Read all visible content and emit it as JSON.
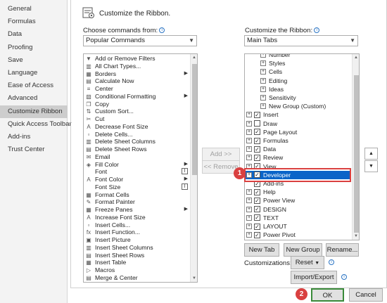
{
  "nav": [
    "General",
    "Formulas",
    "Data",
    "Proofing",
    "Save",
    "Language",
    "Ease of Access",
    "Advanced",
    "Customize Ribbon",
    "Quick Access Toolbar",
    "Add-ins",
    "Trust Center"
  ],
  "nav_selected": 8,
  "header": {
    "title": "Customize the Ribbon."
  },
  "left": {
    "label": "Choose commands from:",
    "select_value": "Popular Commands",
    "commands": [
      {
        "icon": "add-remove-filters-icon",
        "glyph": "▼",
        "label": "Add or Remove Filters"
      },
      {
        "icon": "all-chart-types-icon",
        "glyph": "▥",
        "label": "All Chart Types..."
      },
      {
        "icon": "borders-icon",
        "glyph": "▦",
        "label": "Borders",
        "sub": true
      },
      {
        "icon": "calculate-now-icon",
        "glyph": "▤",
        "label": "Calculate Now"
      },
      {
        "icon": "center-icon",
        "glyph": "≡",
        "label": "Center"
      },
      {
        "icon": "conditional-formatting-icon",
        "glyph": "▧",
        "label": "Conditional Formatting",
        "sub": true
      },
      {
        "icon": "copy-icon",
        "glyph": "❐",
        "label": "Copy"
      },
      {
        "icon": "custom-sort-icon",
        "glyph": "⇅",
        "label": "Custom Sort..."
      },
      {
        "icon": "cut-icon",
        "glyph": "✂",
        "label": "Cut"
      },
      {
        "icon": "decrease-font-size-icon",
        "glyph": "A",
        "label": "Decrease Font Size"
      },
      {
        "icon": "delete-cells-icon",
        "glyph": "▫",
        "label": "Delete Cells..."
      },
      {
        "icon": "delete-sheet-columns-icon",
        "glyph": "▥",
        "label": "Delete Sheet Columns"
      },
      {
        "icon": "delete-sheet-rows-icon",
        "glyph": "▤",
        "label": "Delete Sheet Rows"
      },
      {
        "icon": "email-icon",
        "glyph": "✉",
        "label": "Email"
      },
      {
        "icon": "fill-color-icon",
        "glyph": "◈",
        "label": "Fill Color",
        "sub": true
      },
      {
        "icon": "font-icon",
        "glyph": "",
        "label": "Font",
        "input": true
      },
      {
        "icon": "font-color-icon",
        "glyph": "A",
        "label": "Font Color",
        "sub": true
      },
      {
        "icon": "font-size-icon",
        "glyph": "",
        "label": "Font Size",
        "input": true
      },
      {
        "icon": "format-cells-icon",
        "glyph": "▦",
        "label": "Format Cells"
      },
      {
        "icon": "format-painter-icon",
        "glyph": "✎",
        "label": "Format Painter"
      },
      {
        "icon": "freeze-panes-icon",
        "glyph": "▦",
        "label": "Freeze Panes",
        "sub": true
      },
      {
        "icon": "increase-font-size-icon",
        "glyph": "A",
        "label": "Increase Font Size"
      },
      {
        "icon": "insert-cells-icon",
        "glyph": "▫",
        "label": "Insert Cells..."
      },
      {
        "icon": "insert-function-icon",
        "glyph": "fx",
        "label": "Insert Function..."
      },
      {
        "icon": "insert-picture-icon",
        "glyph": "▣",
        "label": "Insert Picture"
      },
      {
        "icon": "insert-sheet-columns-icon",
        "glyph": "▥",
        "label": "Insert Sheet Columns"
      },
      {
        "icon": "insert-sheet-rows-icon",
        "glyph": "▤",
        "label": "Insert Sheet Rows"
      },
      {
        "icon": "insert-table-icon",
        "glyph": "▦",
        "label": "Insert Table"
      },
      {
        "icon": "macros-icon",
        "glyph": "▷",
        "label": "Macros"
      },
      {
        "icon": "merge-center-icon",
        "glyph": "▤",
        "label": "Merge & Center"
      }
    ]
  },
  "middle": {
    "add": "Add >>",
    "remove": "<< Remove"
  },
  "right": {
    "label": "Customize the Ribbon:",
    "select_value": "Main Tabs",
    "tree": [
      {
        "level": 2,
        "pm": "+",
        "label": "Number"
      },
      {
        "level": 2,
        "pm": "+",
        "label": "Styles"
      },
      {
        "level": 2,
        "pm": "+",
        "label": "Cells"
      },
      {
        "level": 2,
        "pm": "+",
        "label": "Editing"
      },
      {
        "level": 2,
        "pm": "+",
        "label": "Ideas"
      },
      {
        "level": 2,
        "pm": "+",
        "label": "Sensitivity"
      },
      {
        "level": 2,
        "pm": "+",
        "label": "New Group (Custom)"
      },
      {
        "level": 1,
        "pm": "+",
        "cb": "☑",
        "label": "Insert"
      },
      {
        "level": 1,
        "pm": "+",
        "cb": "☐",
        "label": "Draw"
      },
      {
        "level": 1,
        "pm": "+",
        "cb": "☑",
        "label": "Page Layout"
      },
      {
        "level": 1,
        "pm": "+",
        "cb": "☑",
        "label": "Formulas"
      },
      {
        "level": 1,
        "pm": "+",
        "cb": "☑",
        "label": "Data"
      },
      {
        "level": 1,
        "pm": "+",
        "cb": "☑",
        "label": "Review"
      },
      {
        "level": 1,
        "pm": "+",
        "cb": "☑",
        "label": "View"
      },
      {
        "level": 1,
        "pm": "+",
        "cb": "☑",
        "label": "Developer",
        "selected": true
      },
      {
        "level": 1,
        "pm": "",
        "cb": "☑",
        "label": "Add-ins"
      },
      {
        "level": 1,
        "pm": "+",
        "cb": "☑",
        "label": "Help"
      },
      {
        "level": 1,
        "pm": "+",
        "cb": "☑",
        "label": "Power View"
      },
      {
        "level": 1,
        "pm": "+",
        "cb": "☑",
        "label": "DESIGN"
      },
      {
        "level": 1,
        "pm": "+",
        "cb": "☑",
        "label": "TEXT"
      },
      {
        "level": 1,
        "pm": "+",
        "cb": "☑",
        "label": "LAYOUT"
      },
      {
        "level": 1,
        "pm": "+",
        "cb": "☑",
        "label": "Power Pivot"
      }
    ],
    "new_tab": "New Tab",
    "new_group": "New Group",
    "rename": "Rename...",
    "customizations_label": "Customizations:",
    "reset": "Reset",
    "import_export": "Import/Export"
  },
  "badges": {
    "one": "1",
    "two": "2"
  },
  "footer": {
    "ok": "OK",
    "cancel": "Cancel"
  },
  "colors": {
    "selection": "#0a64c8",
    "highlight_box": "#d94040",
    "ok_border": "#3a8a3a"
  }
}
